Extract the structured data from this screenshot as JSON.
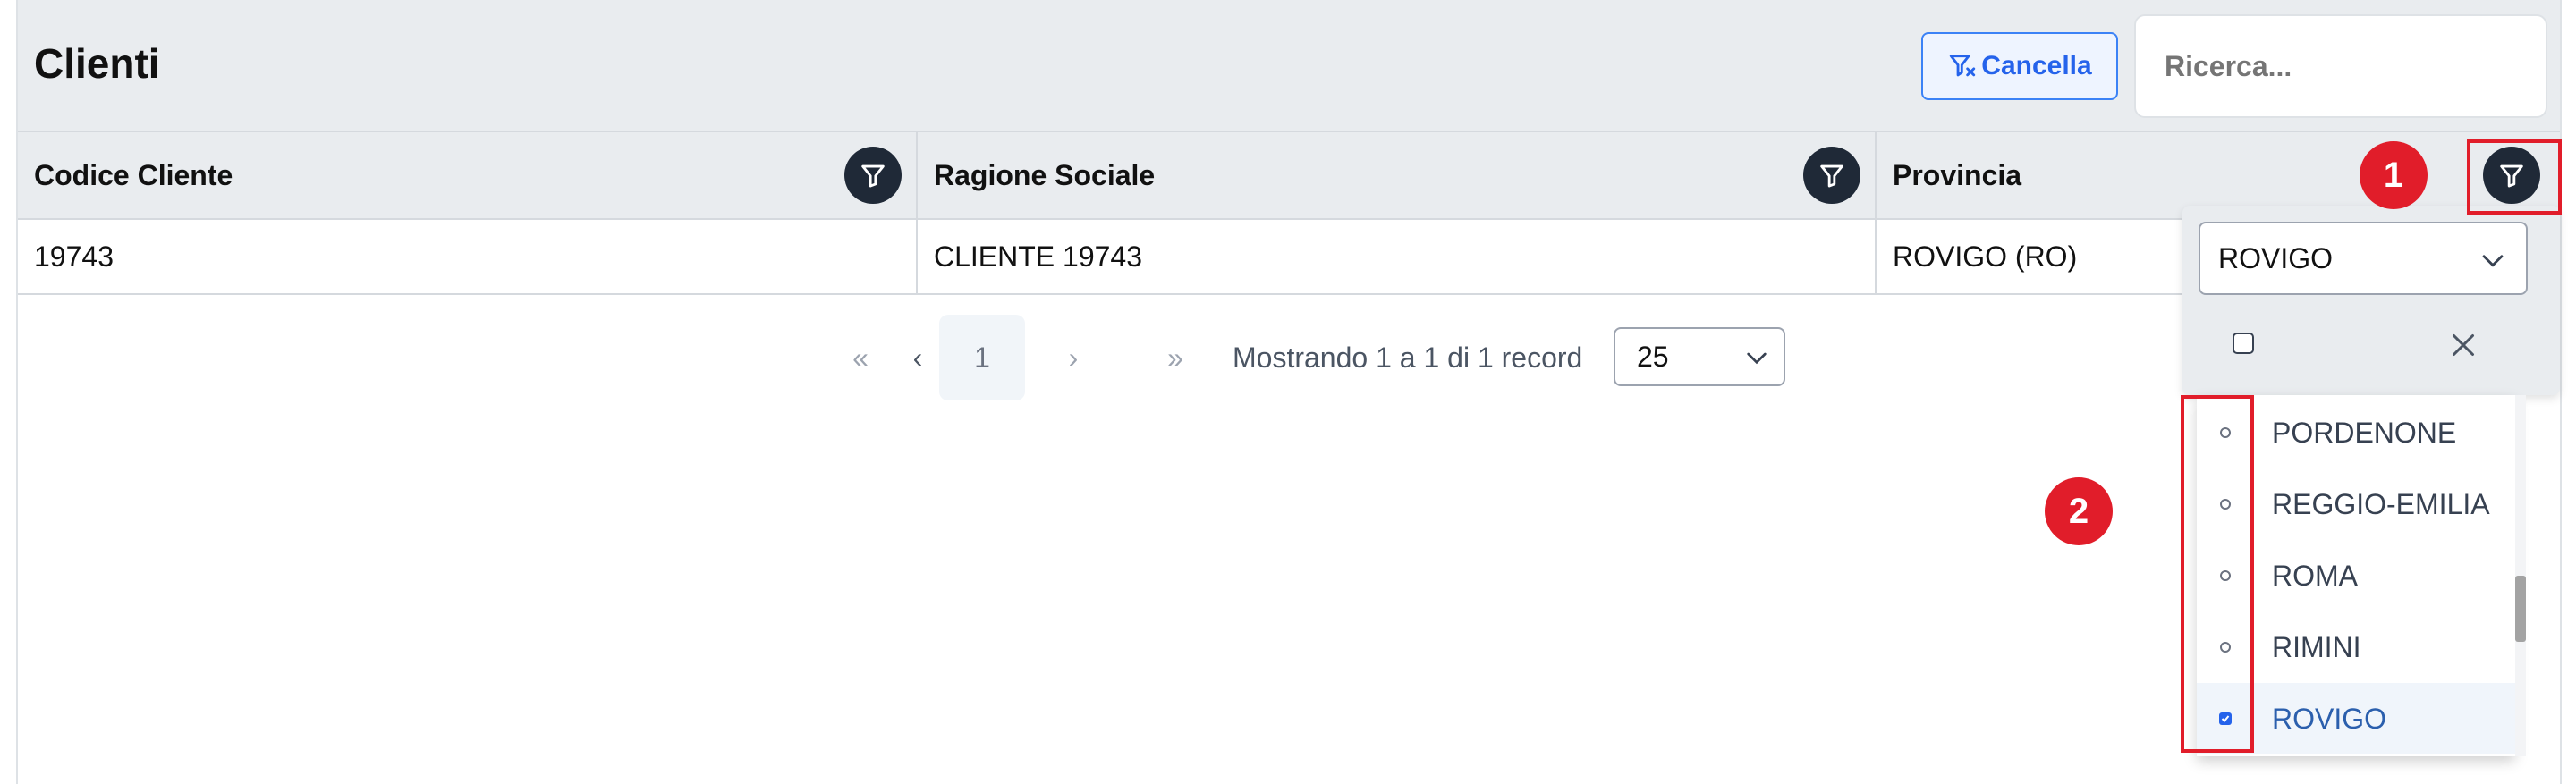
{
  "header": {
    "title": "Clienti",
    "clear_button_label": "Cancella",
    "search_placeholder": "Ricerca..."
  },
  "table": {
    "columns": [
      {
        "label": "Codice Cliente"
      },
      {
        "label": "Ragione Sociale"
      },
      {
        "label": "Provincia"
      }
    ],
    "rows": [
      {
        "codice": "19743",
        "ragione": "CLIENTE 19743",
        "provincia": "ROVIGO (RO)"
      }
    ]
  },
  "pager": {
    "first": "«",
    "prev": "‹",
    "current_page": "1",
    "next": "›",
    "last": "»",
    "info": "Mostrando 1 a 1 di 1 record",
    "page_size": "25"
  },
  "province_filter": {
    "selected_value": "ROVIGO",
    "options": [
      {
        "label": "PORDENONE",
        "selected": false
      },
      {
        "label": "REGGIO-EMILIA",
        "selected": false
      },
      {
        "label": "ROMA",
        "selected": false
      },
      {
        "label": "RIMINI",
        "selected": false
      },
      {
        "label": "ROVIGO",
        "selected": true
      }
    ]
  },
  "annotations": {
    "badge_1": "1",
    "badge_2": "2"
  },
  "colors": {
    "accent": "#2563eb",
    "annotation_red": "#e11d2a",
    "filter_button": "#1f2937"
  }
}
